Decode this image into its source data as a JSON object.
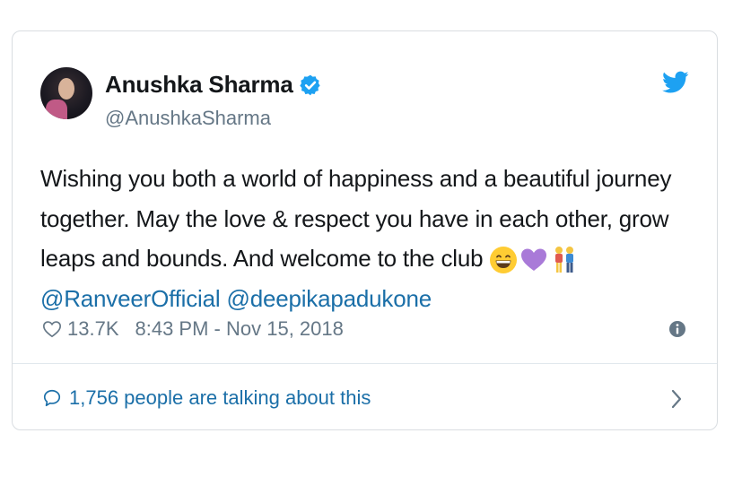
{
  "user": {
    "name": "Anushka Sharma",
    "handle": "@AnushkaSharma"
  },
  "tweet": {
    "line1": "Wishing you both a world of happiness and a beautiful journey",
    "line2": "together. May the love & respect you have in each other, grow",
    "line3": "leaps and bounds. And welcome to the club",
    "mention1": "@RanveerOfficial",
    "mention2": "@deepikapadukone",
    "emojis": [
      "grinning-face-emoji",
      "purple-heart-emoji",
      "couple-emoji"
    ]
  },
  "meta": {
    "likes": "13.7K",
    "timestamp": "8:43 PM - Nov 15, 2018"
  },
  "footer": {
    "talking": "1,756 people are talking about this"
  },
  "colors": {
    "link": "#1b6fa8",
    "verified": "#1da1f2",
    "secondary_text": "#657786"
  }
}
